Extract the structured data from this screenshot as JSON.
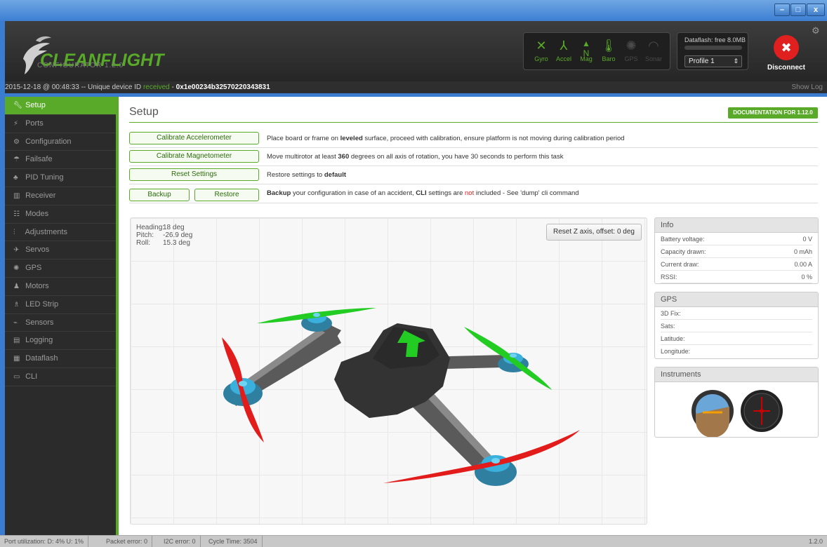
{
  "window": {
    "minimize": "–",
    "maximize": "□",
    "close": "x"
  },
  "app": {
    "logo_text": "CLEANFLIGHT",
    "subtitle": "CONFIGURATOR 1.2.0"
  },
  "sensors": [
    {
      "label": "Gyro",
      "icon": "gyro-icon",
      "active": true
    },
    {
      "label": "Accel",
      "icon": "accel-icon",
      "active": true
    },
    {
      "label": "Mag",
      "icon": "mag-icon",
      "active": true
    },
    {
      "label": "Baro",
      "icon": "baro-icon",
      "active": true
    },
    {
      "label": "GPS",
      "icon": "gps-icon",
      "active": false
    },
    {
      "label": "Sonar",
      "icon": "sonar-icon",
      "active": false
    }
  ],
  "dataflash": {
    "label": "Dataflash: free 8.0MB"
  },
  "profile": {
    "selected": "Profile 1"
  },
  "disconnect": {
    "label": "Disconnect"
  },
  "log": {
    "date": "2015-12-18 @ 00:48:33 -- Unique device ID ",
    "received": "received",
    "sep": " - ",
    "device_id": "0x1e00234b32570220343831",
    "show_log": "Show Log"
  },
  "nav": [
    {
      "label": "Setup",
      "icon": "wrench-icon",
      "active": true
    },
    {
      "label": "Ports",
      "icon": "ports-icon"
    },
    {
      "label": "Configuration",
      "icon": "gear-icon"
    },
    {
      "label": "Failsafe",
      "icon": "failsafe-icon"
    },
    {
      "label": "PID Tuning",
      "icon": "pid-icon"
    },
    {
      "label": "Receiver",
      "icon": "receiver-icon"
    },
    {
      "label": "Modes",
      "icon": "modes-icon"
    },
    {
      "label": "Adjustments",
      "icon": "adjustments-icon"
    },
    {
      "label": "Servos",
      "icon": "servos-icon"
    },
    {
      "label": "GPS",
      "icon": "gps-icon"
    },
    {
      "label": "Motors",
      "icon": "motors-icon"
    },
    {
      "label": "LED Strip",
      "icon": "led-icon"
    },
    {
      "label": "Sensors",
      "icon": "sensors-icon"
    },
    {
      "label": "Logging",
      "icon": "logging-icon"
    },
    {
      "label": "Dataflash",
      "icon": "dataflash-icon"
    },
    {
      "label": "CLI",
      "icon": "cli-icon"
    }
  ],
  "setup": {
    "title": "Setup",
    "doc_button": "DOCUMENTATION FOR 1.12.0",
    "calib_acc": "Calibrate Accelerometer",
    "calib_acc_desc": {
      "a": "Place board or frame on ",
      "b": "leveled",
      "c": " surface, proceed with calibration, ensure platform is not moving during calibration period"
    },
    "calib_mag": "Calibrate Magnetometer",
    "calib_mag_desc": {
      "a": "Move multirotor at least ",
      "b": "360",
      "c": " degrees on all axis of rotation, you have 30 seconds to perform this task"
    },
    "reset": "Reset Settings",
    "reset_desc": {
      "a": "Restore settings to ",
      "b": "default"
    },
    "backup": "Backup",
    "restore": "Restore",
    "backup_desc": {
      "a": "Backup",
      "b": " your configuration in case of an accident, ",
      "c": "CLI",
      "d": " settings are ",
      "e": "not",
      "f": " included - See 'dump' cli command"
    }
  },
  "attitude": {
    "heading_label": "Heading:",
    "heading": "18 deg",
    "pitch_label": "Pitch:",
    "pitch": "-26.9 deg",
    "roll_label": "Roll:",
    "roll": "15.3 deg",
    "reset_z": "Reset Z axis, offset: 0 deg"
  },
  "info": {
    "title": "Info",
    "rows": [
      {
        "k": "Battery voltage:",
        "v": "0 V"
      },
      {
        "k": "Capacity drawn:",
        "v": "0 mAh"
      },
      {
        "k": "Current draw:",
        "v": "0.00 A"
      },
      {
        "k": "RSSI:",
        "v": "0 %"
      }
    ]
  },
  "gps": {
    "title": "GPS",
    "rows": [
      {
        "k": "3D Fix:",
        "v": ""
      },
      {
        "k": "Sats:",
        "v": ""
      },
      {
        "k": "Latitude:",
        "v": ""
      },
      {
        "k": "Longitude:",
        "v": ""
      }
    ]
  },
  "instruments": {
    "title": "Instruments"
  },
  "status": {
    "port": "Port utilization: D: 4% U: 1%",
    "packet": "Packet error: 0",
    "i2c": "I2C error: 0",
    "cycle": "Cycle Time: 3504",
    "version": "1.2.0"
  },
  "colors": {
    "accent": "#59aa29",
    "prop_green": "#22cc22",
    "prop_red": "#e21b1b",
    "error": "#e0201f"
  }
}
